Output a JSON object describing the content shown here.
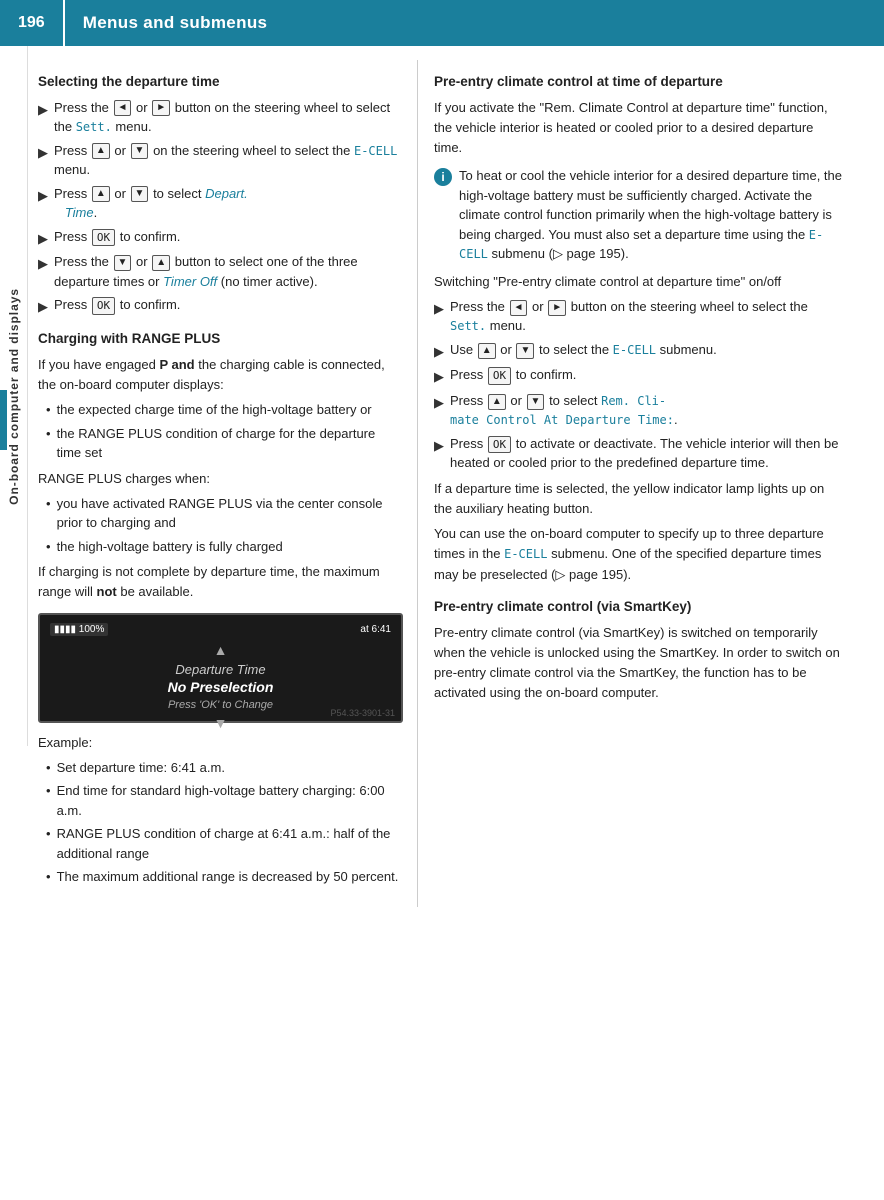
{
  "header": {
    "page_number": "196",
    "title": "Menus and submenus"
  },
  "sidebar": {
    "label": "On-board computer and displays"
  },
  "left_column": {
    "section1_heading": "Selecting the departure time",
    "arrow_items": [
      {
        "id": "l1",
        "text_parts": [
          {
            "type": "text",
            "content": "Press the "
          },
          {
            "type": "btn",
            "content": "◄"
          },
          {
            "type": "text",
            "content": " or "
          },
          {
            "type": "btn",
            "content": "►"
          },
          {
            "type": "text",
            "content": " button on the steering wheel to select the "
          },
          {
            "type": "link",
            "content": "Sett."
          },
          {
            "type": "text",
            "content": " menu."
          }
        ]
      },
      {
        "id": "l2",
        "text_parts": [
          {
            "type": "text",
            "content": "Press "
          },
          {
            "type": "btn",
            "content": "▲"
          },
          {
            "type": "text",
            "content": " or "
          },
          {
            "type": "btn",
            "content": "▼"
          },
          {
            "type": "text",
            "content": " on the steering wheel to select the "
          },
          {
            "type": "link",
            "content": "E-CELL"
          },
          {
            "type": "text",
            "content": " menu."
          }
        ]
      },
      {
        "id": "l3",
        "text_parts": [
          {
            "type": "text",
            "content": "Press "
          },
          {
            "type": "btn",
            "content": "▲"
          },
          {
            "type": "text",
            "content": " or "
          },
          {
            "type": "btn",
            "content": "▼"
          },
          {
            "type": "text",
            "content": " to select "
          },
          {
            "type": "link-italic",
            "content": "Depart. Time"
          },
          {
            "type": "text",
            "content": "."
          }
        ]
      },
      {
        "id": "l4",
        "text_parts": [
          {
            "type": "text",
            "content": "Press "
          },
          {
            "type": "btn",
            "content": "OK"
          },
          {
            "type": "text",
            "content": " to confirm."
          }
        ]
      },
      {
        "id": "l5",
        "text_parts": [
          {
            "type": "text",
            "content": "Press the "
          },
          {
            "type": "btn",
            "content": "▼"
          },
          {
            "type": "text",
            "content": " or "
          },
          {
            "type": "btn",
            "content": "▲"
          },
          {
            "type": "text",
            "content": " button to select one of the three departure times or "
          },
          {
            "type": "link-italic",
            "content": "Timer Off"
          },
          {
            "type": "text",
            "content": " (no timer active)."
          }
        ]
      },
      {
        "id": "l6",
        "text_parts": [
          {
            "type": "text",
            "content": "Press "
          },
          {
            "type": "btn",
            "content": "OK"
          },
          {
            "type": "text",
            "content": " to confirm."
          }
        ]
      }
    ],
    "section2_heading": "Charging with RANGE PLUS",
    "section2_para": "If you have engaged P and the charging cable is connected, the on-board computer displays:",
    "section2_bullets": [
      "the expected charge time of the high-voltage battery or",
      "the RANGE PLUS condition of charge for the departure time set"
    ],
    "range_plus_heading": "RANGE PLUS charges when:",
    "range_plus_bullets": [
      "you have activated RANGE PLUS via the center console prior to charging and",
      "the high-voltage battery is fully charged"
    ],
    "section2_footer": "If charging is not complete by departure time, the maximum range will not be available.",
    "screen": {
      "battery_label": "100%",
      "time_label": "at 6:41",
      "arrow_up": "▲",
      "main_text": "Departure Time",
      "sub_text": "No Preselection",
      "hint_text": "Press 'OK' to Change",
      "arrow_down": "▼",
      "watermark": "P54.33-3901-31"
    },
    "example_heading": "Example:",
    "example_bullets": [
      "Set departure time: 6:41 a.m.",
      "End time for standard high-voltage battery charging: 6:00 a.m.",
      "RANGE PLUS condition of charge at 6:41 a.m.: half of the additional range",
      "The maximum additional range is decreased by 50 percent."
    ]
  },
  "right_column": {
    "section1_heading": "Pre-entry climate control at time of departure",
    "section1_para": "If you activate the \"Rem. Climate Control at departure time\" function, the vehicle interior is heated or cooled prior to a desired departure time.",
    "info_box_text": "To heat or cool the vehicle interior for a desired departure time, the high-voltage battery must be sufficiently charged. Activate the climate control function primarily when the high-voltage battery is being charged. You must also set a departure time using the E-CELL submenu (▷ page 195).",
    "switch_heading": "Switching \"Pre-entry climate control at departure time\" on/off",
    "switch_items": [
      {
        "id": "r1",
        "text_parts": [
          {
            "type": "text",
            "content": "Press the "
          },
          {
            "type": "btn",
            "content": "◄"
          },
          {
            "type": "text",
            "content": " or "
          },
          {
            "type": "btn",
            "content": "►"
          },
          {
            "type": "text",
            "content": " button on the steering wheel to select the "
          },
          {
            "type": "link",
            "content": "Sett."
          },
          {
            "type": "text",
            "content": " menu."
          }
        ]
      },
      {
        "id": "r2",
        "text_parts": [
          {
            "type": "text",
            "content": "Use "
          },
          {
            "type": "btn",
            "content": "▲"
          },
          {
            "type": "text",
            "content": " or "
          },
          {
            "type": "btn",
            "content": "▼"
          },
          {
            "type": "text",
            "content": " to select the "
          },
          {
            "type": "link",
            "content": "E-CELL"
          },
          {
            "type": "text",
            "content": " submenu."
          }
        ]
      },
      {
        "id": "r3",
        "text_parts": [
          {
            "type": "text",
            "content": "Press "
          },
          {
            "type": "btn",
            "content": "OK"
          },
          {
            "type": "text",
            "content": " to confirm."
          }
        ]
      },
      {
        "id": "r4",
        "text_parts": [
          {
            "type": "text",
            "content": "Press "
          },
          {
            "type": "btn",
            "content": "▲"
          },
          {
            "type": "text",
            "content": " or "
          },
          {
            "type": "btn",
            "content": "▼"
          },
          {
            "type": "text",
            "content": " to select "
          },
          {
            "type": "mono-colored",
            "content": "Rem. Climate Control At Departure Time:"
          },
          {
            "type": "text",
            "content": "."
          }
        ]
      },
      {
        "id": "r5",
        "text_parts": [
          {
            "type": "text",
            "content": "Press "
          },
          {
            "type": "btn",
            "content": "OK"
          },
          {
            "type": "text",
            "content": " to activate or deactivate. The vehicle interior will then be heated or cooled prior to the predefined departure time."
          }
        ]
      }
    ],
    "after_switch_para1": "If a departure time is selected, the yellow indicator lamp lights up on the auxiliary heating button.",
    "after_switch_para2": "You can use the on-board computer to specify up to three departure times in the E-CELL submenu. One of the specified departure times may be preselected (▷ page 195).",
    "section2_heading": "Pre-entry climate control (via SmartKey)",
    "section2_para": "Pre-entry climate control (via SmartKey) is switched on temporarily when the vehicle is unlocked using the SmartKey. In order to switch on pre-entry climate control via the SmartKey, the function has to be activated using the on-board computer."
  }
}
